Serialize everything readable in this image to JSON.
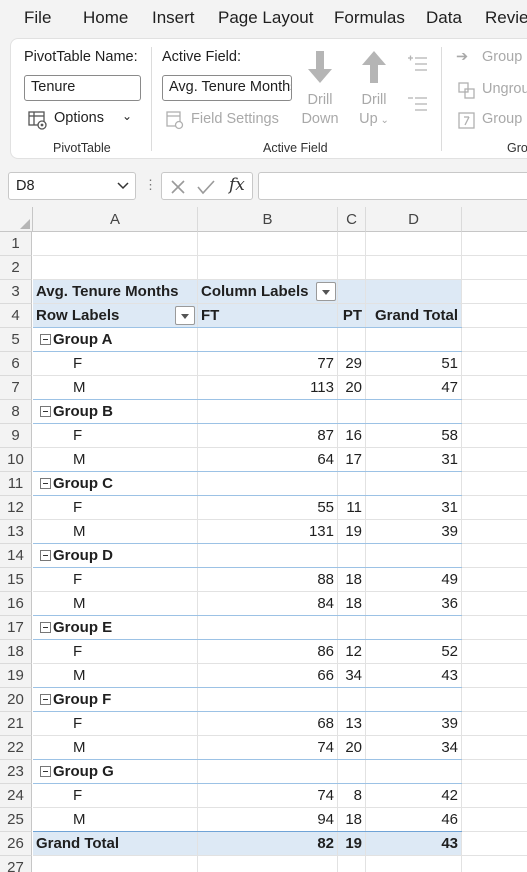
{
  "menu": [
    "File",
    "Home",
    "Insert",
    "Page Layout",
    "Formulas",
    "Data",
    "Review"
  ],
  "ribbon": {
    "pivottable_name_label": "PivotTable Name:",
    "pivottable_name_value": "Tenure",
    "options_label": "Options",
    "group_pivottable": "PivotTable",
    "active_field_label": "Active Field:",
    "active_field_value": "Avg. Tenure Months",
    "field_settings_label": "Field Settings",
    "drill_down_line1": "Drill",
    "drill_down_line2": "Down",
    "drill_up_line1": "Drill",
    "drill_up_line2": "Up",
    "group_active_field": "Active Field",
    "group_selection": "Group Selection",
    "ungroup": "Ungroup",
    "group_field": "Group Field",
    "group_group": "Group"
  },
  "formula_bar": {
    "name_box": "D8",
    "fx": "fx",
    "formula": ""
  },
  "columns": [
    "A",
    "B",
    "C",
    "D"
  ],
  "pivot": {
    "value_field": "Avg. Tenure Months",
    "column_labels": "Column Labels",
    "row_labels": "Row Labels",
    "col_ft": "FT",
    "col_pt": "PT",
    "col_grand_total": "Grand Total",
    "groups": [
      {
        "name": "Group A",
        "rows": [
          {
            "label": "F",
            "ft": "77",
            "pt": "29",
            "gt": "51"
          },
          {
            "label": "M",
            "ft": "113",
            "pt": "20",
            "gt": "47"
          }
        ]
      },
      {
        "name": "Group B",
        "rows": [
          {
            "label": "F",
            "ft": "87",
            "pt": "16",
            "gt": "58"
          },
          {
            "label": "M",
            "ft": "64",
            "pt": "17",
            "gt": "31"
          }
        ]
      },
      {
        "name": "Group C",
        "rows": [
          {
            "label": "F",
            "ft": "55",
            "pt": "11",
            "gt": "31"
          },
          {
            "label": "M",
            "ft": "131",
            "pt": "19",
            "gt": "39"
          }
        ]
      },
      {
        "name": "Group D",
        "rows": [
          {
            "label": "F",
            "ft": "88",
            "pt": "18",
            "gt": "49"
          },
          {
            "label": "M",
            "ft": "84",
            "pt": "18",
            "gt": "36"
          }
        ]
      },
      {
        "name": "Group E",
        "rows": [
          {
            "label": "F",
            "ft": "86",
            "pt": "12",
            "gt": "52"
          },
          {
            "label": "M",
            "ft": "66",
            "pt": "34",
            "gt": "43"
          }
        ]
      },
      {
        "name": "Group F",
        "rows": [
          {
            "label": "F",
            "ft": "68",
            "pt": "13",
            "gt": "39"
          },
          {
            "label": "M",
            "ft": "74",
            "pt": "20",
            "gt": "34"
          }
        ]
      },
      {
        "name": "Group G",
        "rows": [
          {
            "label": "F",
            "ft": "74",
            "pt": "8",
            "gt": "42"
          },
          {
            "label": "M",
            "ft": "94",
            "pt": "18",
            "gt": "46"
          }
        ]
      }
    ],
    "grand_total_label": "Grand Total",
    "grand_total": {
      "ft": "82",
      "pt": "19",
      "gt": "43"
    }
  }
}
